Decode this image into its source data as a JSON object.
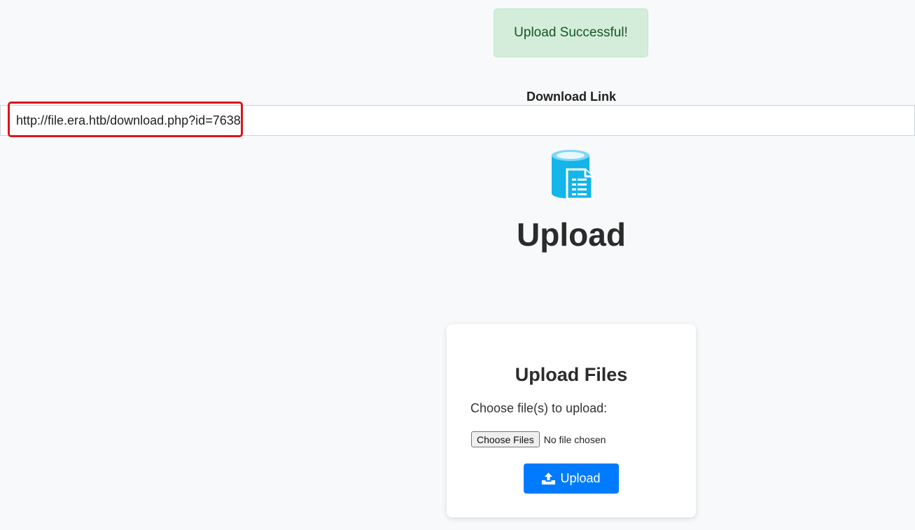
{
  "alert": {
    "message": "Upload Successful!"
  },
  "download": {
    "label": "Download Link",
    "url": "http://file.era.htb/download.php?id=7638"
  },
  "header": {
    "icon": "database-file-icon",
    "title": "Upload"
  },
  "upload_card": {
    "title": "Upload Files",
    "choose_label": "Choose file(s) to upload:",
    "choose_button": "Choose Files",
    "no_file_text": "No file chosen",
    "upload_button": "Upload",
    "upload_icon": "upload-icon"
  },
  "colors": {
    "accent": "#007bff",
    "success_bg": "#d4edda",
    "success_text": "#155724",
    "highlight": "#d9151b",
    "icon_color": "#13b5ea"
  }
}
